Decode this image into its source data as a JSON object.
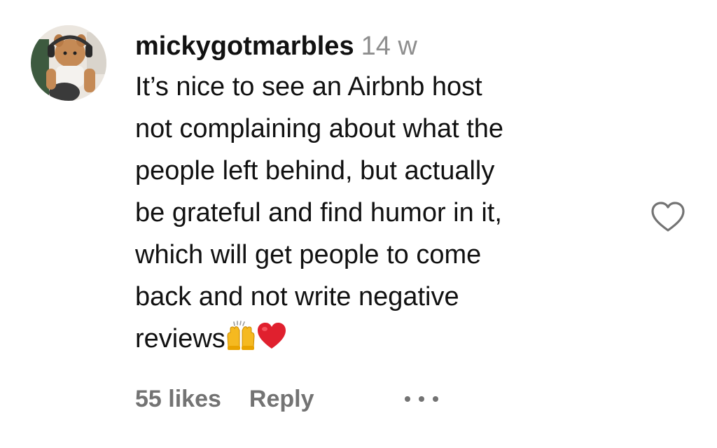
{
  "comment": {
    "username": "mickygotmarbles",
    "timestamp": "14 w",
    "lines": [
      "It’s nice to see an Airbnb host",
      "not complaining about what the",
      "people left behind, but actually",
      "be grateful and find humor in it,",
      "which will get people to come",
      "back and not write negative",
      "reviews"
    ],
    "emojis": [
      "raising-hands-emoji",
      "red-heart-emoji"
    ],
    "likes_label": "55 likes",
    "reply_label": "Reply"
  },
  "icons": {
    "like": "heart-outline-icon",
    "more": "more-options-icon"
  },
  "colors": {
    "text": "#111111",
    "secondary": "#737373",
    "timestamp": "#8e8e8e",
    "heart_emoji": "#e0202e",
    "raising_hands": "#f5b920"
  }
}
